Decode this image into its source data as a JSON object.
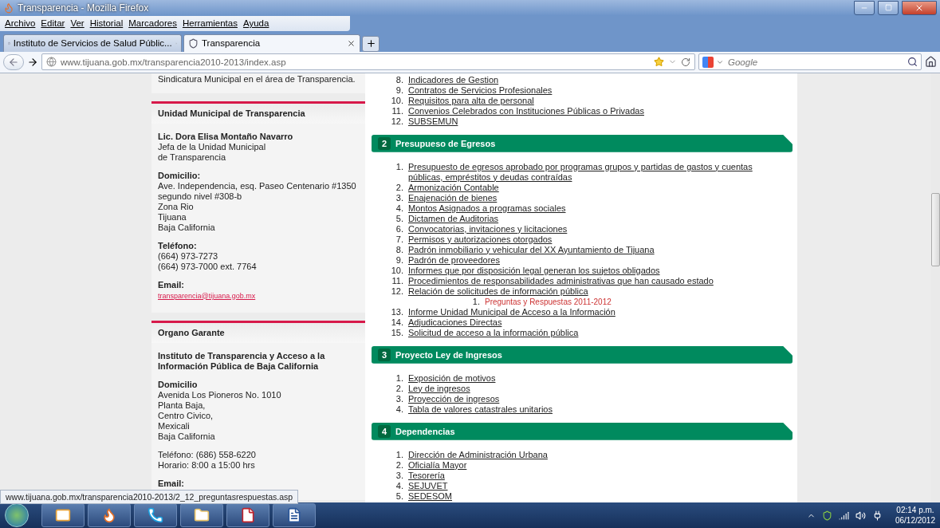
{
  "window": {
    "title": "Transparencia - Mozilla Firefox"
  },
  "menu_bar": [
    "Archivo",
    "Editar",
    "Ver",
    "Historial",
    "Marcadores",
    "Herramientas",
    "Ayuda"
  ],
  "tabs": [
    {
      "label": "Instituto de Servicios de Salud Públic...",
      "selected": false
    },
    {
      "label": "Transparencia",
      "selected": true
    }
  ],
  "address_bar": {
    "url": "www.tijuana.gob.mx/transparencia2010-2013/index.asp"
  },
  "search": {
    "placeholder": "Google"
  },
  "sidebar": {
    "intro": "Sindicatura Municipal en el área de Transparencia.",
    "panels": [
      {
        "title": "Unidad Municipal de Transparencia",
        "blocks": [
          {
            "heading": "Lic. Dora Elisa Montaño Navarro",
            "lines": [
              "Jefa de la Unidad Municipal",
              "de Transparencia"
            ]
          },
          {
            "heading": "Domicilio:",
            "lines": [
              "Ave. Independencia, esq. Paseo Centenario #1350",
              "segundo nivel #308-b",
              "Zona Rio",
              "Tijuana",
              "Baja California"
            ]
          },
          {
            "heading": "Teléfono:",
            "lines": [
              "(664) 973-7273",
              "(664) 973-7000 ext. 7764"
            ]
          },
          {
            "heading": "Email:",
            "link": "transparencia@tijuana.gob.mx"
          }
        ]
      },
      {
        "title": "Organo Garante",
        "blocks": [
          {
            "heading": "Instituto de Transparencia y Acceso a la Información Pública de Baja California"
          },
          {
            "heading": "Domicilio",
            "lines": [
              "Avenida Los Pioneros No. 1010",
              "Planta Baja,",
              "Centro Civico,",
              "Mexicali",
              "Baja California"
            ]
          },
          {
            "lines": [
              "Teléfono: (686) 558-6220",
              "Horario: 8:00 a 15:00 hrs"
            ]
          },
          {
            "heading": "Email:"
          }
        ]
      }
    ]
  },
  "top_list": [
    {
      "number": "8.",
      "label": "Indicadores de Gestion"
    },
    {
      "number": "9.",
      "label": "Contratos de Servicios Profesionales"
    },
    {
      "number": "10.",
      "label": "Requisitos para alta de personal"
    },
    {
      "number": "11.",
      "label": "Convenios Celebrados con Instituciones Públicas o Privadas"
    },
    {
      "number": "12.",
      "label": "SUBSEMUN"
    }
  ],
  "sections": [
    {
      "number": "2",
      "title": "Presupueso de Egresos",
      "items": [
        {
          "number": "1.",
          "label": "Presupuesto de egresos aprobado por programas grupos y partidas de gastos y cuentas públicas, empréstitos y deudas contraídas"
        },
        {
          "number": "2.",
          "label": "Armonización Contable"
        },
        {
          "number": "3.",
          "label": "Enajenación de bienes"
        },
        {
          "number": "4.",
          "label": "Montos Asignados a programas sociales"
        },
        {
          "number": "5.",
          "label": "Dictamen de Auditorias"
        },
        {
          "number": "6.",
          "label": "Convocatorias, invitaciones y licitaciones"
        },
        {
          "number": "7.",
          "label": "Permisos y autorizaciones otorgados"
        },
        {
          "number": "8.",
          "label": "Padrón inmobiliario y vehicular del XX Ayuntamiento de Tijuana"
        },
        {
          "number": "9.",
          "label": "Padrón de proveedores"
        },
        {
          "number": "10.",
          "label": "Informes que por disposición legal generan los sujetos obligados"
        },
        {
          "number": "11.",
          "label": "Procedimientos de responsabilidades administrativas que han causado estado"
        },
        {
          "number": "12.",
          "label": "Relación de solicitudes de información pública",
          "children": [
            {
              "number": "1.",
              "label": "Preguntas y Respuestas 2011-2012"
            }
          ]
        },
        {
          "number": "13.",
          "label": "Informe Unidad Municipal de Acceso a la Información"
        },
        {
          "number": "14.",
          "label": "Adjudicaciones Directas"
        },
        {
          "number": "15.",
          "label": "Solicitud de acceso a la información pública"
        }
      ]
    },
    {
      "number": "3",
      "title": "Proyecto Ley de Ingresos",
      "items": [
        {
          "number": "1.",
          "label": "Exposición de motivos"
        },
        {
          "number": "2.",
          "label": "Ley de ingresos"
        },
        {
          "number": "3.",
          "label": "Proyección de ingresos"
        },
        {
          "number": "4.",
          "label": "Tabla de valores catastrales unitarios"
        }
      ]
    },
    {
      "number": "4",
      "title": "Dependencias",
      "items": [
        {
          "number": "1.",
          "label": "Dirección de Administración Urbana"
        },
        {
          "number": "2.",
          "label": "Oficialía Mayor"
        },
        {
          "number": "3.",
          "label": "Tesorería"
        },
        {
          "number": "4.",
          "label": "SEJUVET"
        },
        {
          "number": "5.",
          "label": "SEDESOM"
        }
      ]
    }
  ],
  "status_bar": "www.tijuana.gob.mx/transparencia2010-2013/2_12_preguntasrespuestas.asp",
  "taskbar": {
    "apps": [
      {
        "kind": "mail"
      },
      {
        "kind": "browser"
      },
      {
        "kind": "phone"
      },
      {
        "kind": "folder"
      },
      {
        "kind": "pdf"
      },
      {
        "kind": "document"
      }
    ],
    "time": "02:14 p.m.",
    "date": "06/12/2012"
  }
}
